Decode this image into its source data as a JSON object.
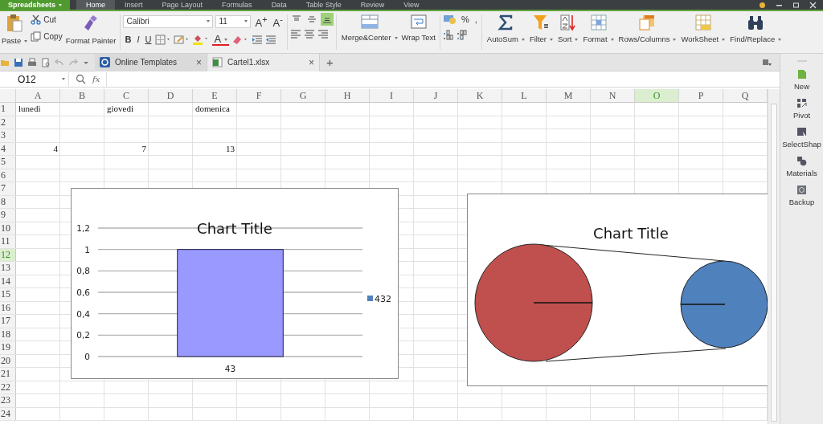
{
  "menu_bar": {
    "app": "Spreadsheets",
    "tabs": [
      {
        "label": "Home",
        "selected": true
      },
      {
        "label": "Insert",
        "selected": false
      },
      {
        "label": "Page Layout",
        "selected": false
      },
      {
        "label": "Formulas",
        "selected": false
      },
      {
        "label": "Data",
        "selected": false
      },
      {
        "label": "Table Style",
        "selected": false
      },
      {
        "label": "Review",
        "selected": false
      },
      {
        "label": "View",
        "selected": false
      }
    ]
  },
  "ribbon": {
    "clipboard": {
      "paste": "Paste",
      "cut": "Cut",
      "copy": "Copy",
      "format_painter": "Format Painter"
    },
    "font": {
      "family": "Calibri",
      "size": "11",
      "grow": "A$^{+}$",
      "shrink": "A$^{-}$",
      "bold": "B",
      "italic": "I",
      "underline": "U",
      "font_color": "A"
    },
    "vertical_align": [
      {
        "kind": "top",
        "selected": false
      },
      {
        "kind": "middle",
        "selected": false
      },
      {
        "kind": "bottom",
        "selected": true
      }
    ],
    "merge": "Merge&Center",
    "wrap": "Wrap Text",
    "number": {
      "percent": "%",
      "comma": ","
    },
    "tools": [
      {
        "kind": "sum",
        "label": "AutoSum"
      },
      {
        "kind": "filter",
        "label": "Filter"
      },
      {
        "kind": "sort",
        "label": "Sort"
      },
      {
        "kind": "format",
        "label": "Format"
      },
      {
        "kind": "rows",
        "label": "Rows/Columns"
      },
      {
        "kind": "worksheet",
        "label": "WorkSheet"
      },
      {
        "kind": "find",
        "label": "Find/Replace"
      }
    ]
  },
  "doc_tabs": {
    "tabs": [
      {
        "kind": "templates",
        "label": "Online Templates",
        "close": "×",
        "selected": false
      },
      {
        "kind": "sheet",
        "label": "Cartel1.xlsx",
        "close": "×",
        "selected": true
      }
    ],
    "new_tab": "+"
  },
  "formula_bar": {
    "cell": "O12",
    "fx": "fx"
  },
  "sheet": {
    "columns": [
      {
        "label": "A",
        "selected": false
      },
      {
        "label": "B",
        "selected": false
      },
      {
        "label": "C",
        "selected": false
      },
      {
        "label": "D",
        "selected": false
      },
      {
        "label": "E",
        "selected": false
      },
      {
        "label": "F",
        "selected": false
      },
      {
        "label": "G",
        "selected": false
      },
      {
        "label": "H",
        "selected": false
      },
      {
        "label": "I",
        "selected": false
      },
      {
        "label": "J",
        "selected": false
      },
      {
        "label": "K",
        "selected": false
      },
      {
        "label": "L",
        "selected": false
      },
      {
        "label": "M",
        "selected": false
      },
      {
        "label": "N",
        "selected": false
      },
      {
        "label": "O",
        "selected": true
      },
      {
        "label": "P",
        "selected": false
      },
      {
        "label": "Q",
        "selected": false
      }
    ],
    "rows": [
      {
        "label": "1",
        "selected": false,
        "cells": [
          {
            "kind": "text",
            "value": "lunedi"
          },
          null,
          {
            "kind": "text",
            "value": "giovedi"
          },
          null,
          {
            "kind": "text",
            "value": "domenica"
          }
        ]
      },
      {
        "label": "2",
        "selected": false
      },
      {
        "label": "3",
        "selected": false
      },
      {
        "label": "4",
        "selected": false,
        "cells": [
          {
            "kind": "number",
            "value": "4"
          },
          null,
          {
            "kind": "number",
            "value": "7"
          },
          null,
          {
            "kind": "number",
            "value": "13"
          }
        ]
      },
      {
        "label": "5",
        "selected": false
      },
      {
        "label": "6",
        "selected": false
      },
      {
        "label": "7",
        "selected": false
      },
      {
        "label": "8",
        "selected": false
      },
      {
        "label": "9",
        "selected": false
      },
      {
        "label": "10",
        "selected": false
      },
      {
        "label": "11",
        "selected": false
      },
      {
        "label": "12",
        "selected": true
      },
      {
        "label": "13",
        "selected": false
      },
      {
        "label": "14",
        "selected": false
      },
      {
        "label": "15",
        "selected": false
      },
      {
        "label": "16",
        "selected": false
      },
      {
        "label": "17",
        "selected": false
      },
      {
        "label": "18",
        "selected": false
      },
      {
        "label": "19",
        "selected": false
      },
      {
        "label": "20",
        "selected": false
      },
      {
        "label": "21",
        "selected": false
      },
      {
        "label": "22",
        "selected": false
      },
      {
        "label": "23",
        "selected": false
      },
      {
        "label": "24",
        "selected": false
      }
    ],
    "bar_chart": {
      "chart_data": {
        "type": "bar",
        "title": "Chart Title",
        "categories": [
          "43"
        ],
        "series": [
          {
            "name": "432",
            "color": "#9999ff",
            "values": [
              1
            ]
          }
        ],
        "ylim": [
          0,
          1.2
        ],
        "grid": true,
        "yticks": [
          {
            "value": 0,
            "label": "0"
          },
          {
            "value": 0.2,
            "label": "0,2"
          },
          {
            "value": 0.4,
            "label": "0,4"
          },
          {
            "value": 0.6,
            "label": "0,6"
          },
          {
            "value": 0.8,
            "label": "0,8"
          },
          {
            "value": 1,
            "label": "1"
          },
          {
            "value": 1.2,
            "label": "1,2"
          }
        ]
      }
    },
    "pie_chart": {
      "title": "Chart Title"
    }
  },
  "side_panel": [
    {
      "kind": "new",
      "label": "New"
    },
    {
      "kind": "pivot",
      "label": "Pivot"
    },
    {
      "kind": "select",
      "label": "SelectShap"
    },
    {
      "kind": "materials",
      "label": "Materials"
    },
    {
      "kind": "backup",
      "label": "Backup"
    }
  ]
}
